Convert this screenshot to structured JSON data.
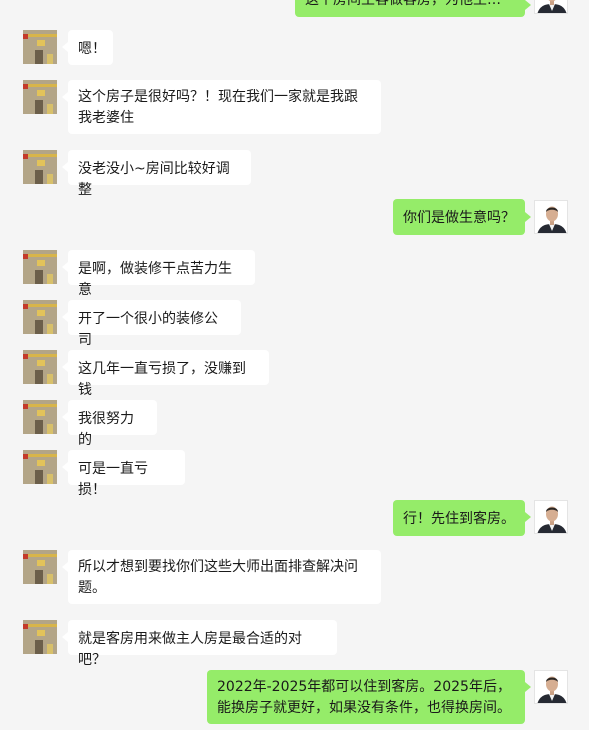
{
  "conversation": {
    "messages": [
      {
        "side": "right",
        "text": "这个房间主客做客房，为他生…"
      },
      {
        "side": "left",
        "text": "嗯！"
      },
      {
        "side": "left",
        "text": "这个房子是很好吗？！现在我们一家就是我跟我老婆住"
      },
      {
        "side": "left",
        "text": "没老没小~房间比较好调整"
      },
      {
        "side": "right",
        "text": "你们是做生意吗？"
      },
      {
        "side": "left",
        "text": "是啊，做装修干点苦力生意"
      },
      {
        "side": "left",
        "text": "开了一个很小的装修公司"
      },
      {
        "side": "left",
        "text": "这几年一直亏损了，没赚到钱"
      },
      {
        "side": "left",
        "text": "我很努力的"
      },
      {
        "side": "left",
        "text": "可是一直亏损！"
      },
      {
        "side": "right",
        "text": "行！先住到客房。"
      },
      {
        "side": "left",
        "text": "所以才想到要找你们这些大师出面排查解决问题。"
      },
      {
        "side": "left",
        "text": "就是客房用来做主人房是最合适的对吧？"
      },
      {
        "side": "right",
        "text": "2022年-2025年都可以住到客房。2025年后，能换房子就更好，如果没有条件，也得换房间。"
      }
    ]
  }
}
